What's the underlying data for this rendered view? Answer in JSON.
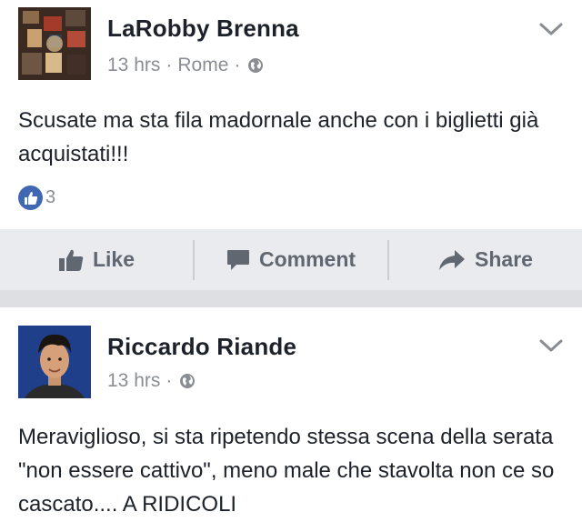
{
  "post1": {
    "author": "LaRobby Brenna",
    "time": "13 hrs",
    "location": "Rome",
    "text": "Scusate ma sta fila madornale anche con i biglietti già acquistati!!!",
    "like_count": "3"
  },
  "actions": {
    "like_label": "Like",
    "comment_label": "Comment",
    "share_label": "Share"
  },
  "post2": {
    "author": "Riccardo Riande",
    "time": "13 hrs",
    "text": "Meraviglioso, si sta ripetendo stessa scena della serata \"non essere cattivo\", meno male che stavolta non ce so cascato.... A RIDICOLI"
  },
  "colors": {
    "accent": "#4267b2",
    "action_bar": "#e9ebee",
    "muted_text": "#8a8d91"
  },
  "icons": {
    "audience": "globe-icon",
    "menu": "chevron-down-icon",
    "like": "thumbs-up-icon",
    "comment": "comment-bubble-icon",
    "share": "share-arrow-icon"
  }
}
